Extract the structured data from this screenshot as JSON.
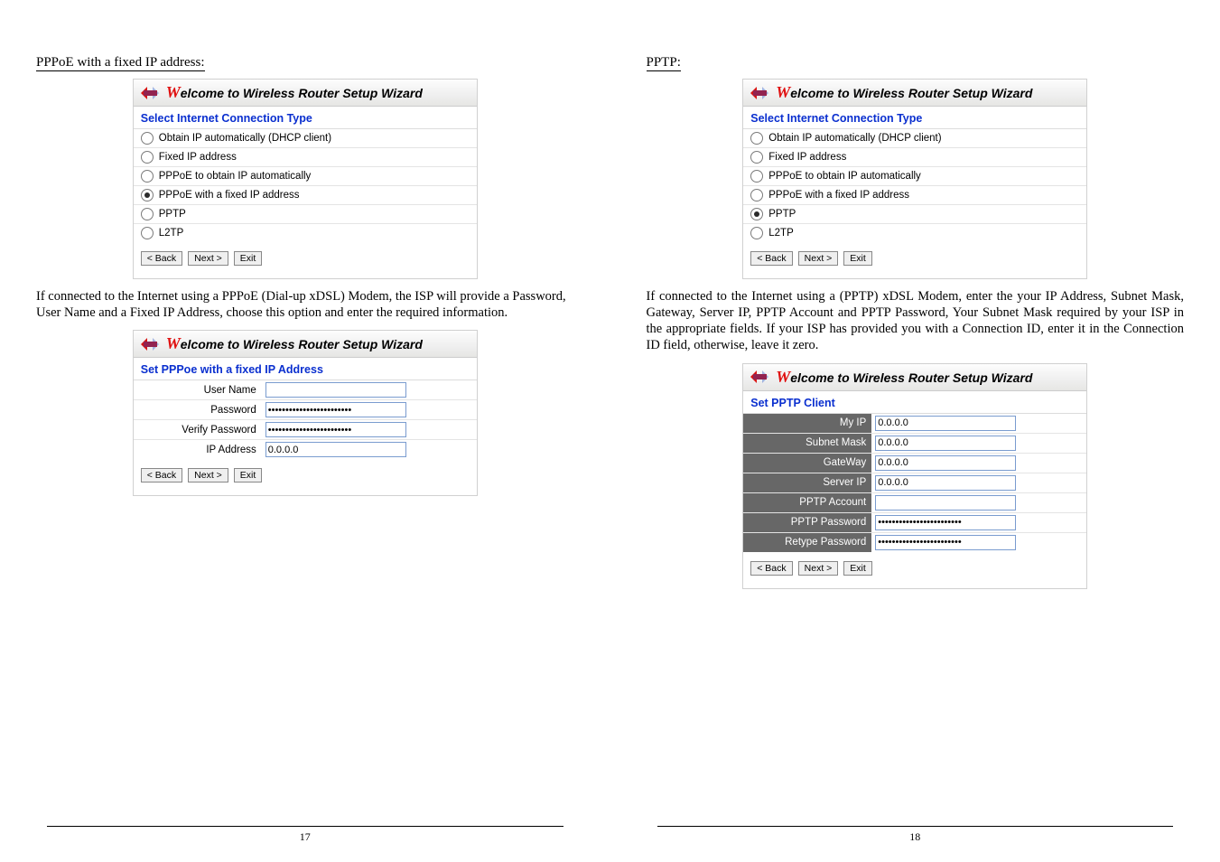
{
  "left": {
    "section_label": "PPPoE with a fixed IP address:",
    "wizard_title_prefix": "W",
    "wizard_title_rest": "elcome to Wireless Router Setup Wizard",
    "select_heading": "Select Internet Connection Type",
    "radios": [
      {
        "label": "Obtain IP automatically (DHCP client)",
        "selected": false
      },
      {
        "label": "Fixed IP address",
        "selected": false
      },
      {
        "label": "PPPoE to obtain IP automatically",
        "selected": false
      },
      {
        "label": "PPPoE with a fixed IP address",
        "selected": true
      },
      {
        "label": "PPTP",
        "selected": false
      },
      {
        "label": "L2TP",
        "selected": false
      }
    ],
    "btn_back": "< Back",
    "btn_next": "Next >",
    "btn_exit": "Exit",
    "paragraph": "If connected to the Internet using a PPPoE (Dial-up xDSL) Modem, the ISP will provide a Password, User Name and a Fixed IP Address, choose this option and enter the required information.",
    "form_heading": "Set PPPoe with a fixed IP Address",
    "form_rows": [
      {
        "label": "User Name",
        "value": "",
        "type": "text"
      },
      {
        "label": "Password",
        "value": "••••••••••••••••••••••••",
        "type": "text"
      },
      {
        "label": "Verify Password",
        "value": "••••••••••••••••••••••••",
        "type": "text"
      },
      {
        "label": "IP Address",
        "value": "0.0.0.0",
        "type": "text"
      }
    ],
    "page_number": "17"
  },
  "right": {
    "section_label": "PPTP:",
    "wizard_title_prefix": "W",
    "wizard_title_rest": "elcome to Wireless Router Setup Wizard",
    "select_heading": "Select Internet Connection Type",
    "radios": [
      {
        "label": "Obtain IP automatically (DHCP client)",
        "selected": false
      },
      {
        "label": "Fixed IP address",
        "selected": false
      },
      {
        "label": "PPPoE to obtain IP automatically",
        "selected": false
      },
      {
        "label": "PPPoE with a fixed IP address",
        "selected": false
      },
      {
        "label": "PPTP",
        "selected": true
      },
      {
        "label": "L2TP",
        "selected": false
      }
    ],
    "btn_back": "< Back",
    "btn_next": "Next >",
    "btn_exit": "Exit",
    "paragraph": "If connected to the Internet using a (PPTP) xDSL Modem, enter the your IP Address, Subnet Mask, Gateway, Server IP, PPTP Account and PPTP Password, Your Subnet Mask required by your ISP in the appropriate fields. If your ISP has provided you with a Connection ID, enter it in the Connection ID field, otherwise, leave it zero.",
    "form_heading": "Set PPTP Client",
    "form_rows": [
      {
        "label": "My IP",
        "value": "0.0.0.0"
      },
      {
        "label": "Subnet Mask",
        "value": "0.0.0.0"
      },
      {
        "label": "GateWay",
        "value": "0.0.0.0"
      },
      {
        "label": "Server IP",
        "value": "0.0.0.0"
      },
      {
        "label": "PPTP Account",
        "value": ""
      },
      {
        "label": "PPTP Password",
        "value": "••••••••••••••••••••••••"
      },
      {
        "label": "Retype Password",
        "value": "••••••••••••••••••••••••"
      }
    ],
    "page_number": "18"
  }
}
